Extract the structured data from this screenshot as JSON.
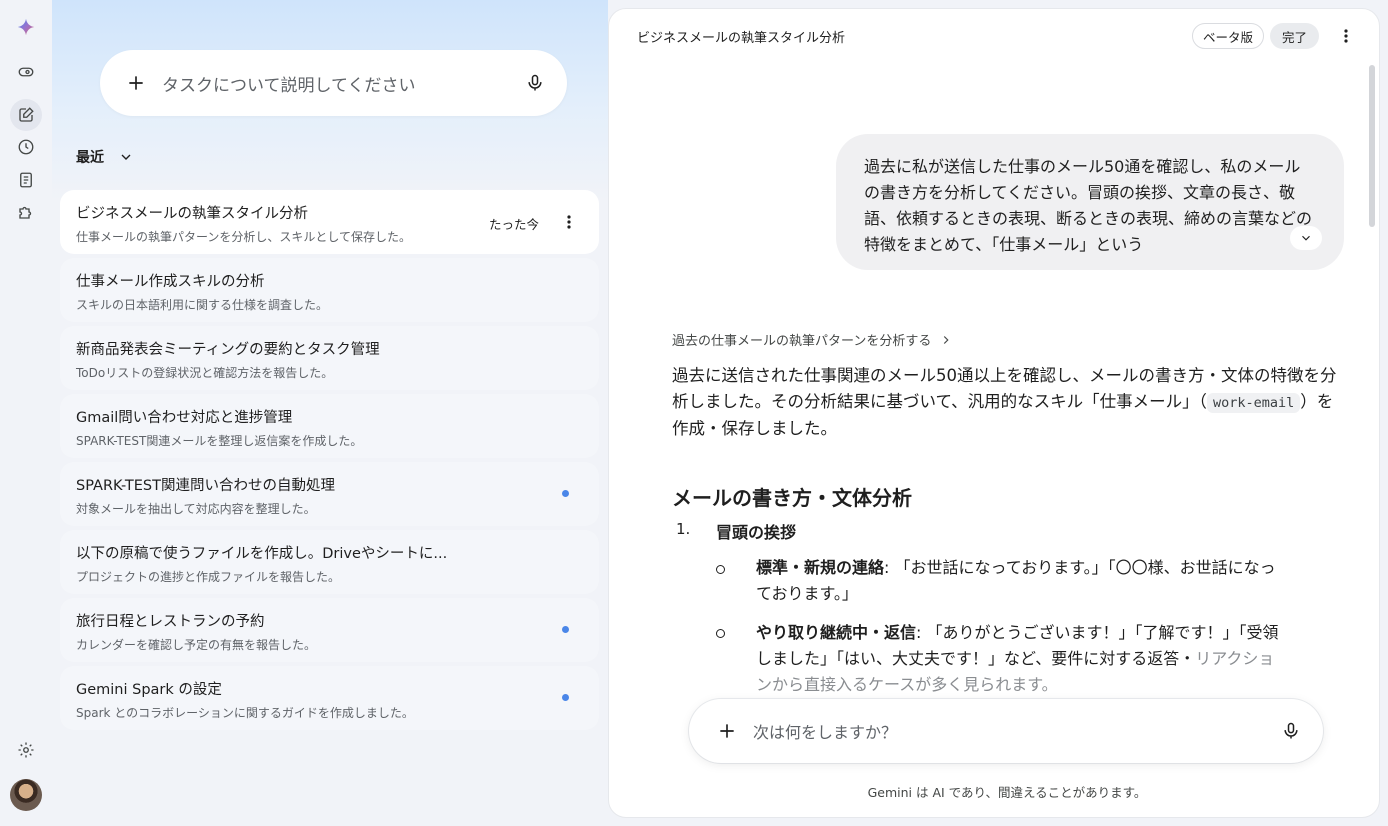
{
  "rail": {
    "logo": "gemini-sparkle-icon",
    "items": [
      "view-icon",
      "new-chat-icon",
      "history-icon",
      "notes-icon",
      "puzzle-icon"
    ],
    "settings": "gear-icon",
    "avatar": "user-avatar"
  },
  "left": {
    "task_placeholder": "タスクについて説明してください",
    "recent_label": "最近",
    "items": [
      {
        "title": "ビジネスメールの執筆スタイル分析",
        "sub": "仕事メールの執筆パターンを分析し、スキルとして保存した。",
        "time": "たった今"
      },
      {
        "title": "仕事メール作成スキルの分析",
        "sub": "スキルの日本語利用に関する仕様を調査した。"
      },
      {
        "title": "新商品発表会ミーティングの要約とタスク管理",
        "sub": "ToDoリストの登録状況と確認方法を報告した。"
      },
      {
        "title": "Gmail問い合わせ対応と進捗管理",
        "sub": "SPARK-TEST関連メールを整理し返信案を作成した。"
      },
      {
        "title": "SPARK-TEST関連問い合わせの自動処理",
        "sub": "対象メールを抽出して対応内容を整理した。"
      },
      {
        "title": "以下の原稿で使うファイルを作成し。Driveやシートに...",
        "sub": "プロジェクトの進捗と作成ファイルを報告した。"
      },
      {
        "title": "旅行日程とレストランの予約",
        "sub": "カレンダーを確認し予定の有無を報告した。"
      },
      {
        "title": "Gemini Spark の設定",
        "sub": "Spark とのコラボレーションに関するガイドを作成しました。"
      }
    ]
  },
  "right": {
    "title": "ビジネスメールの執筆スタイル分析",
    "beta_label": "ベータ版",
    "done_label": "完了",
    "user_message": "過去に私が送信した仕事のメール50通を確認し、私のメールの書き方を分析してください。冒頭の挨拶、文章の長さ、敬語、依頼するときの表現、断るときの表現、締めの言葉などの特徴をまとめて、「仕事メール」という",
    "thought_label": "過去の仕事メールの執筆パターンを分析する",
    "answer_part1": "過去に送信された仕事関連のメール50通以上を確認し、メールの書き方・文体の特徴を分析しました。その分析結果に基づいて、汎用的なスキル「仕事メール」（",
    "answer_code": "work-email",
    "answer_part2": "）を作成・保存しました。",
    "section_title": "メールの書き方・文体分析",
    "list_num": "1.",
    "list_title": "冒頭の挨拶",
    "bullet1_label": "標準・新規の連絡",
    "bullet1_text": ": 「お世話になっております。」「〇〇様、お世話になっております。」",
    "bullet2_label": "やり取り継続中・返信",
    "bullet2_text": ": 「ありがとうございます！」「了解です！」「受領しました」「はい、大丈夫です！」など、要件に対する返答・",
    "bullet2_fade": "リアクションから直接入るケースが多く見られます。",
    "input_placeholder": "次は何をしますか？",
    "disclaimer": "Gemini は AI であり、間違えることがあります。"
  },
  "colors": {
    "accent": "#4a86e8",
    "background": "#f1f3f8"
  }
}
